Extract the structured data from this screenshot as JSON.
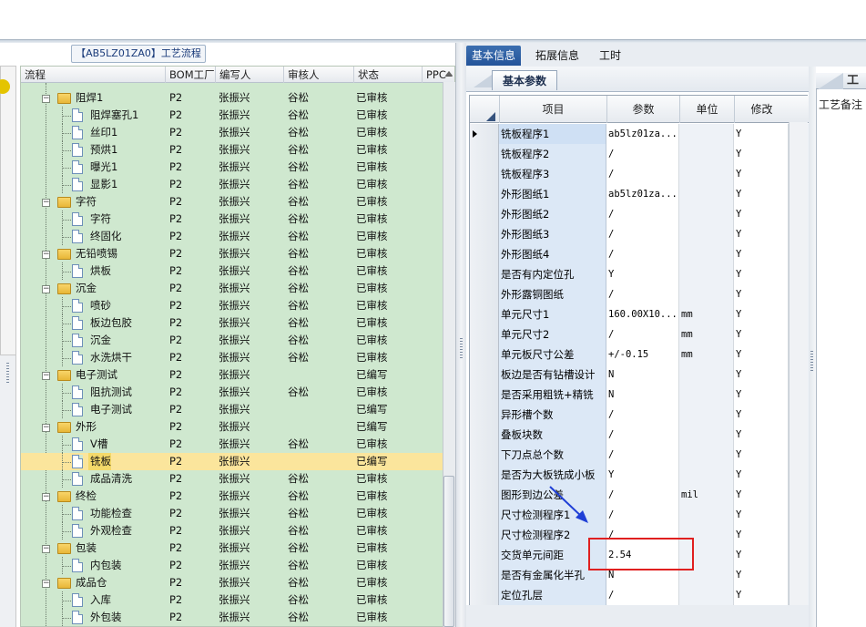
{
  "left_panel": {
    "title": "【AB5LZ01ZA0】工艺流程",
    "columns": [
      "流程",
      "BOM工厂",
      "编写人",
      "审核人",
      "状态",
      "PPC"
    ],
    "rows": [
      {
        "name": "阻焊1",
        "type": "folder",
        "level": 1,
        "factory": "P2",
        "writer": "张振兴",
        "reviewer": "谷松",
        "status": "已审核"
      },
      {
        "name": "阻焊塞孔1",
        "type": "doc",
        "level": 2,
        "factory": "P2",
        "writer": "张振兴",
        "reviewer": "谷松",
        "status": "已审核"
      },
      {
        "name": "丝印1",
        "type": "doc",
        "level": 2,
        "factory": "P2",
        "writer": "张振兴",
        "reviewer": "谷松",
        "status": "已审核"
      },
      {
        "name": "预烘1",
        "type": "doc",
        "level": 2,
        "factory": "P2",
        "writer": "张振兴",
        "reviewer": "谷松",
        "status": "已审核"
      },
      {
        "name": "曝光1",
        "type": "doc",
        "level": 2,
        "factory": "P2",
        "writer": "张振兴",
        "reviewer": "谷松",
        "status": "已审核"
      },
      {
        "name": "显影1",
        "type": "doc",
        "level": 2,
        "factory": "P2",
        "writer": "张振兴",
        "reviewer": "谷松",
        "status": "已审核"
      },
      {
        "name": "字符",
        "type": "folder",
        "level": 1,
        "factory": "P2",
        "writer": "张振兴",
        "reviewer": "谷松",
        "status": "已审核"
      },
      {
        "name": "字符",
        "type": "doc",
        "level": 2,
        "factory": "P2",
        "writer": "张振兴",
        "reviewer": "谷松",
        "status": "已审核"
      },
      {
        "name": "终固化",
        "type": "doc",
        "level": 2,
        "factory": "P2",
        "writer": "张振兴",
        "reviewer": "谷松",
        "status": "已审核"
      },
      {
        "name": "无铅喷锡",
        "type": "folder",
        "level": 1,
        "factory": "P2",
        "writer": "张振兴",
        "reviewer": "谷松",
        "status": "已审核"
      },
      {
        "name": "烘板",
        "type": "doc",
        "level": 2,
        "factory": "P2",
        "writer": "张振兴",
        "reviewer": "谷松",
        "status": "已审核"
      },
      {
        "name": "沉金",
        "type": "folder",
        "level": 1,
        "factory": "P2",
        "writer": "张振兴",
        "reviewer": "谷松",
        "status": "已审核"
      },
      {
        "name": "喷砂",
        "type": "doc",
        "level": 2,
        "factory": "P2",
        "writer": "张振兴",
        "reviewer": "谷松",
        "status": "已审核"
      },
      {
        "name": "板边包胶",
        "type": "doc",
        "level": 2,
        "factory": "P2",
        "writer": "张振兴",
        "reviewer": "谷松",
        "status": "已审核"
      },
      {
        "name": "沉金",
        "type": "doc",
        "level": 2,
        "factory": "P2",
        "writer": "张振兴",
        "reviewer": "谷松",
        "status": "已审核"
      },
      {
        "name": "水洗烘干",
        "type": "doc",
        "level": 2,
        "factory": "P2",
        "writer": "张振兴",
        "reviewer": "谷松",
        "status": "已审核"
      },
      {
        "name": "电子测试",
        "type": "folder",
        "level": 1,
        "factory": "P2",
        "writer": "张振兴",
        "reviewer": "",
        "status": "已编写"
      },
      {
        "name": "阻抗测试",
        "type": "doc",
        "level": 2,
        "factory": "P2",
        "writer": "张振兴",
        "reviewer": "谷松",
        "status": "已审核"
      },
      {
        "name": "电子测试",
        "type": "doc",
        "level": 2,
        "factory": "P2",
        "writer": "张振兴",
        "reviewer": "",
        "status": "已编写"
      },
      {
        "name": "外形",
        "type": "folder",
        "level": 1,
        "factory": "P2",
        "writer": "张振兴",
        "reviewer": "",
        "status": "已编写"
      },
      {
        "name": "V槽",
        "type": "doc",
        "level": 2,
        "factory": "P2",
        "writer": "张振兴",
        "reviewer": "谷松",
        "status": "已审核"
      },
      {
        "name": "铣板",
        "type": "doc",
        "level": 2,
        "factory": "P2",
        "writer": "张振兴",
        "reviewer": "",
        "status": "已编写",
        "selected": true
      },
      {
        "name": "成品清洗",
        "type": "doc",
        "level": 2,
        "factory": "P2",
        "writer": "张振兴",
        "reviewer": "谷松",
        "status": "已审核"
      },
      {
        "name": "终检",
        "type": "folder",
        "level": 1,
        "factory": "P2",
        "writer": "张振兴",
        "reviewer": "谷松",
        "status": "已审核"
      },
      {
        "name": "功能检查",
        "type": "doc",
        "level": 2,
        "factory": "P2",
        "writer": "张振兴",
        "reviewer": "谷松",
        "status": "已审核"
      },
      {
        "name": "外观检查",
        "type": "doc",
        "level": 2,
        "factory": "P2",
        "writer": "张振兴",
        "reviewer": "谷松",
        "status": "已审核"
      },
      {
        "name": "包装",
        "type": "folder",
        "level": 1,
        "factory": "P2",
        "writer": "张振兴",
        "reviewer": "谷松",
        "status": "已审核"
      },
      {
        "name": "内包装",
        "type": "doc",
        "level": 2,
        "factory": "P2",
        "writer": "张振兴",
        "reviewer": "谷松",
        "status": "已审核"
      },
      {
        "name": "成品仓",
        "type": "folder",
        "level": 1,
        "factory": "P2",
        "writer": "张振兴",
        "reviewer": "谷松",
        "status": "已审核"
      },
      {
        "name": "入库",
        "type": "doc",
        "level": 2,
        "factory": "P2",
        "writer": "张振兴",
        "reviewer": "谷松",
        "status": "已审核"
      },
      {
        "name": "外包装",
        "type": "doc",
        "level": 2,
        "factory": "P2",
        "writer": "张振兴",
        "reviewer": "谷松",
        "status": "已审核"
      }
    ]
  },
  "right_panel": {
    "tabs": [
      "基本信息",
      "拓展信息",
      "工时"
    ],
    "active_tab": "基本信息",
    "subtab": "基本参数",
    "columns": [
      "项目",
      "参数",
      "单位",
      "修改"
    ],
    "rows": [
      {
        "item": "铣板程序1",
        "param": "ab5lz01za...",
        "unit": "",
        "edit": "Y"
      },
      {
        "item": "铣板程序2",
        "param": "/",
        "unit": "",
        "edit": "Y"
      },
      {
        "item": "铣板程序3",
        "param": "/",
        "unit": "",
        "edit": "Y"
      },
      {
        "item": "外形图纸1",
        "param": "ab5lz01za...",
        "unit": "",
        "edit": "Y"
      },
      {
        "item": "外形图纸2",
        "param": "/",
        "unit": "",
        "edit": "Y"
      },
      {
        "item": "外形图纸3",
        "param": "/",
        "unit": "",
        "edit": "Y"
      },
      {
        "item": "外形图纸4",
        "param": "/",
        "unit": "",
        "edit": "Y"
      },
      {
        "item": "是否有内定位孔",
        "param": "Y",
        "unit": "",
        "edit": "Y"
      },
      {
        "item": "外形露铜图纸",
        "param": "/",
        "unit": "",
        "edit": "Y"
      },
      {
        "item": "单元尺寸1",
        "param": "160.00X10...",
        "unit": "mm",
        "edit": "Y"
      },
      {
        "item": "单元尺寸2",
        "param": "/",
        "unit": "mm",
        "edit": "Y"
      },
      {
        "item": "单元板尺寸公差",
        "param": "+/-0.15",
        "unit": "mm",
        "edit": "Y"
      },
      {
        "item": "板边是否有钻槽设计",
        "param": "N",
        "unit": "",
        "edit": "Y"
      },
      {
        "item": "是否采用粗铣+精铣",
        "param": "N",
        "unit": "",
        "edit": "Y"
      },
      {
        "item": "异形槽个数",
        "param": "/",
        "unit": "",
        "edit": "Y"
      },
      {
        "item": "叠板块数",
        "param": "/",
        "unit": "",
        "edit": "Y"
      },
      {
        "item": "下刀点总个数",
        "param": "/",
        "unit": "",
        "edit": "Y"
      },
      {
        "item": "是否为大板铣成小板",
        "param": "Y",
        "unit": "",
        "edit": "Y"
      },
      {
        "item": "图形到边公差",
        "param": "/",
        "unit": "mil",
        "edit": "Y"
      },
      {
        "item": "尺寸检测程序1",
        "param": "/",
        "unit": "",
        "edit": "Y"
      },
      {
        "item": "尺寸检测程序2",
        "param": "/",
        "unit": "",
        "edit": "Y"
      },
      {
        "item": "交货单元间距",
        "param": "2.54",
        "unit": "",
        "edit": "Y"
      },
      {
        "item": "是否有金属化半孔",
        "param": "N",
        "unit": "",
        "edit": "Y"
      },
      {
        "item": "定位孔层",
        "param": "/",
        "unit": "",
        "edit": "Y"
      }
    ]
  },
  "far_right": {
    "header": "工",
    "label": "工艺备注"
  },
  "colors": {
    "tree_bg": "#cfe8cf",
    "selected_row": "#fbe59c",
    "active_tab": "#2b5ea3",
    "highlight_box": "#e02020",
    "arrow": "#1f3fd6"
  }
}
